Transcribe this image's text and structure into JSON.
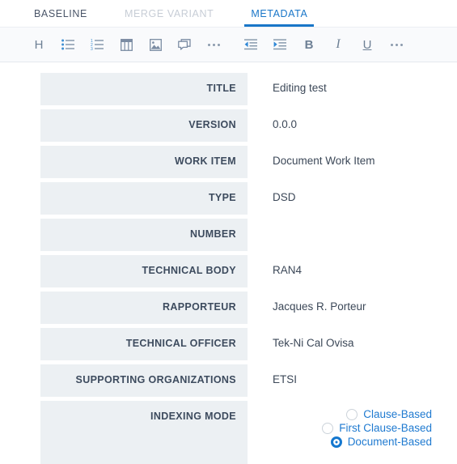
{
  "tabs": [
    {
      "label": "BASELINE",
      "state": "normal"
    },
    {
      "label": "MERGE VARIANT",
      "state": "muted"
    },
    {
      "label": "METADATA",
      "state": "active"
    }
  ],
  "toolbar": {
    "items": [
      {
        "icon": "heading-icon",
        "label": "H"
      },
      {
        "icon": "bulleted-list-icon",
        "label": ""
      },
      {
        "icon": "numbered-list-icon",
        "label": ""
      },
      {
        "icon": "table-icon",
        "label": ""
      },
      {
        "icon": "image-icon",
        "label": ""
      },
      {
        "icon": "comment-icon",
        "label": ""
      },
      {
        "icon": "more-options-icon",
        "label": ""
      },
      {
        "icon": "outdent-icon",
        "label": ""
      },
      {
        "icon": "indent-icon",
        "label": ""
      },
      {
        "icon": "bold-icon",
        "label": "B"
      },
      {
        "icon": "italic-icon",
        "label": "I"
      },
      {
        "icon": "underline-icon",
        "label": "U"
      },
      {
        "icon": "more-options-icon",
        "label": ""
      }
    ]
  },
  "metadata": {
    "fields": [
      {
        "label": "TITLE",
        "value": "Editing test"
      },
      {
        "label": "VERSION",
        "value": "0.0.0"
      },
      {
        "label": "WORK ITEM",
        "value": "Document Work Item"
      },
      {
        "label": "TYPE",
        "value": "DSD"
      },
      {
        "label": "NUMBER",
        "value": ""
      },
      {
        "label": "TECHNICAL BODY",
        "value": "RAN4"
      },
      {
        "label": "RAPPORTEUR",
        "value": "Jacques R. Porteur"
      },
      {
        "label": "TECHNICAL OFFICER",
        "value": "Tek-Ni Cal Ovisa"
      },
      {
        "label": "SUPPORTING ORGANIZATIONS",
        "value": "ETSI"
      }
    ],
    "indexing_mode": {
      "label": "INDEXING MODE",
      "options": [
        {
          "label": "Clause-Based",
          "selected": false
        },
        {
          "label": "First Clause-Based",
          "selected": false
        },
        {
          "label": "Document-Based",
          "selected": true
        }
      ]
    }
  },
  "colors": {
    "accent": "#1976c8",
    "label_bg": "#ecf0f3",
    "text": "#3c4858",
    "muted": "#c7cdd6",
    "toolbar_bg": "#f9fafc"
  }
}
